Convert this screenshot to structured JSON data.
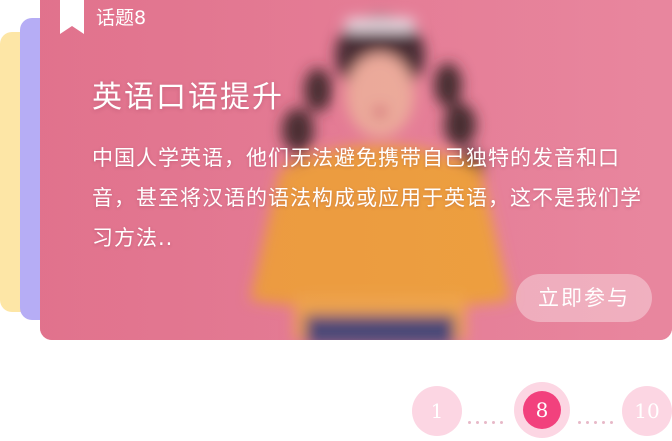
{
  "topic": {
    "label": "话题8",
    "title": "英语口语提升",
    "description": "中国人学英语，他们无法避免携带自己独特的发音和口音，甚至将汉语的语法构成或应用于英语，这不是我们学习方法..",
    "join_label": "立即参与",
    "bookmark_icon": "bookmark-icon"
  },
  "pagination": {
    "first": "1",
    "current": "8",
    "last": "10"
  },
  "colors": {
    "card_pink": "#e8849b",
    "accent": "#f2417d",
    "page_light": "#fcd6e3",
    "stack_yellow": "#fde6a6",
    "stack_purple": "#b6adf5",
    "sweater": "#f0a63a"
  }
}
